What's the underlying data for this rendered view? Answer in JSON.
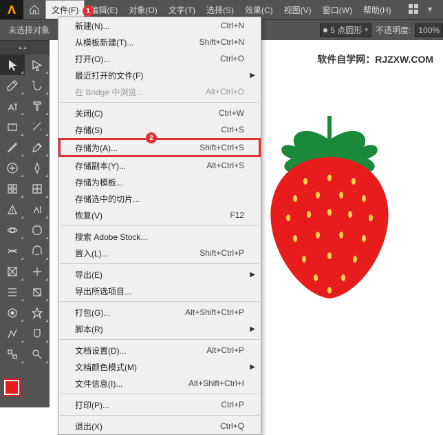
{
  "menubar": {
    "file": "文件(F)",
    "edit": "编辑(E)",
    "object": "对象(O)",
    "type": "文字(T)",
    "select": "选择(S)",
    "effect": "效果(C)",
    "view": "视图(V)",
    "window": "窗口(W)",
    "help": "帮助(H)"
  },
  "badges": {
    "b1": "1",
    "b2": "2"
  },
  "optbar": {
    "noSelection": "未选择对象",
    "strokeLabel": "5 点圆形",
    "opacityLabel": "不透明度:",
    "opacityValue": "100%"
  },
  "watermark": "软件自学网：RJZXW.COM",
  "dropdown": [
    {
      "type": "item",
      "label": "新建(N)...",
      "shortcut": "Ctrl+N"
    },
    {
      "type": "item",
      "label": "从模板新建(T)...",
      "shortcut": "Shift+Ctrl+N"
    },
    {
      "type": "item",
      "label": "打开(O)...",
      "shortcut": "Ctrl+O"
    },
    {
      "type": "sub",
      "label": "最近打开的文件(F)"
    },
    {
      "type": "item",
      "label": "在 Bridge 中浏览...",
      "shortcut": "Alt+Ctrl+O",
      "disabled": true
    },
    {
      "type": "sep"
    },
    {
      "type": "item",
      "label": "关闭(C)",
      "shortcut": "Ctrl+W"
    },
    {
      "type": "item",
      "label": "存储(S)",
      "shortcut": "Ctrl+S"
    },
    {
      "type": "item",
      "label": "存储为(A)...",
      "shortcut": "Shift+Ctrl+S",
      "highlight": true
    },
    {
      "type": "item",
      "label": "存储副本(Y)...",
      "shortcut": "Alt+Ctrl+S"
    },
    {
      "type": "item",
      "label": "存储为模板..."
    },
    {
      "type": "item",
      "label": "存储选中的切片..."
    },
    {
      "type": "item",
      "label": "恢复(V)",
      "shortcut": "F12"
    },
    {
      "type": "sep"
    },
    {
      "type": "item",
      "label": "搜索 Adobe Stock..."
    },
    {
      "type": "item",
      "label": "置入(L)...",
      "shortcut": "Shift+Ctrl+P"
    },
    {
      "type": "sep"
    },
    {
      "type": "sub",
      "label": "导出(E)"
    },
    {
      "type": "item",
      "label": "导出所选项目..."
    },
    {
      "type": "sep"
    },
    {
      "type": "item",
      "label": "打包(G)...",
      "shortcut": "Alt+Shift+Ctrl+P"
    },
    {
      "type": "sub",
      "label": "脚本(R)"
    },
    {
      "type": "sep"
    },
    {
      "type": "item",
      "label": "文档设置(D)...",
      "shortcut": "Alt+Ctrl+P"
    },
    {
      "type": "sub",
      "label": "文档颜色模式(M)"
    },
    {
      "type": "item",
      "label": "文件信息(I)...",
      "shortcut": "Alt+Shift+Ctrl+I"
    },
    {
      "type": "sep"
    },
    {
      "type": "item",
      "label": "打印(P)...",
      "shortcut": "Ctrl+P"
    },
    {
      "type": "sep"
    },
    {
      "type": "item",
      "label": "退出(X)",
      "shortcut": "Ctrl+Q"
    }
  ]
}
